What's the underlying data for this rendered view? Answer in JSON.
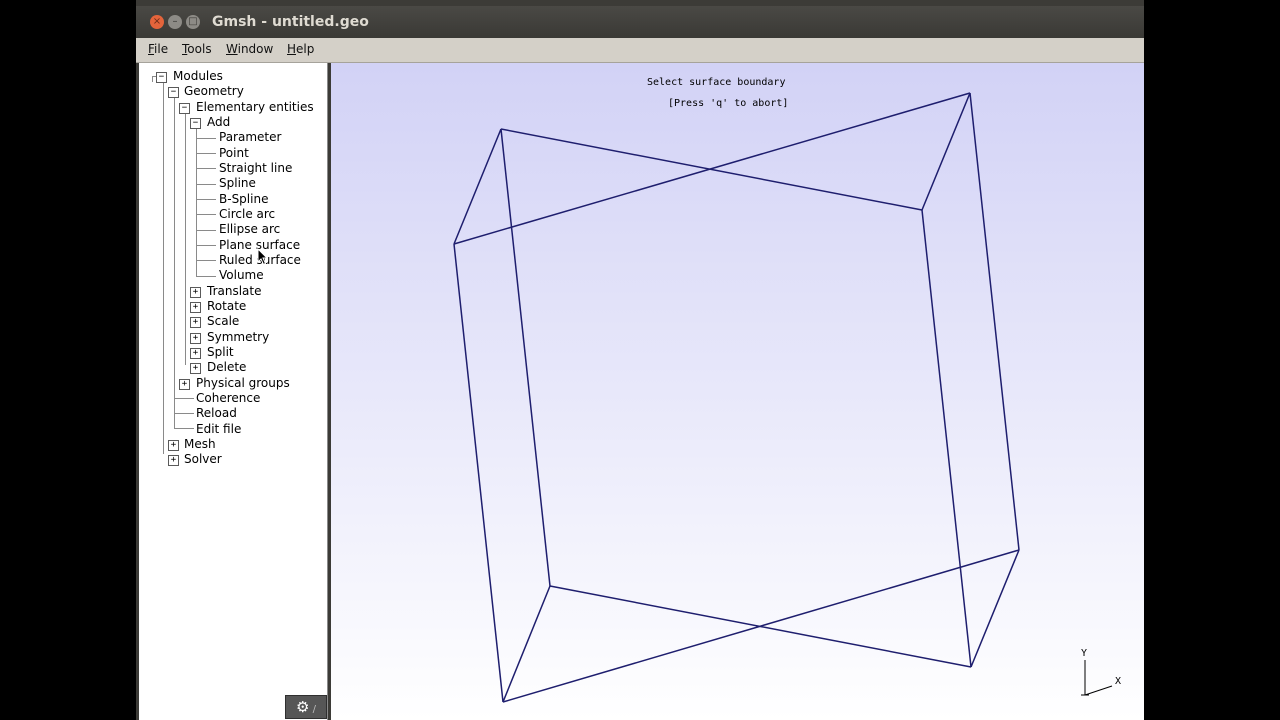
{
  "window": {
    "title": "Gmsh - untitled.geo",
    "close_glyph": "×",
    "min_glyph": "–",
    "max_glyph": "□"
  },
  "menu": {
    "file": {
      "u": "F",
      "rest": "ile"
    },
    "tools": {
      "u": "T",
      "rest": "ools"
    },
    "window": {
      "u": "W",
      "rest": "indow"
    },
    "help": {
      "u": "H",
      "rest": "elp"
    }
  },
  "tree": {
    "modules": "Modules",
    "geometry": "Geometry",
    "elementary": "Elementary entities",
    "add": "Add",
    "parameter": "Parameter",
    "point": "Point",
    "straight_line": "Straight line",
    "spline": "Spline",
    "bspline": "B-Spline",
    "circle_arc": "Circle arc",
    "ellipse_arc": "Ellipse arc",
    "plane_surface": "Plane surface",
    "ruled_surface": "Ruled surface",
    "volume": "Volume",
    "translate": "Translate",
    "rotate": "Rotate",
    "scale": "Scale",
    "symmetry": "Symmetry",
    "split": "Split",
    "delete": "Delete",
    "physical_groups": "Physical groups",
    "coherence": "Coherence",
    "reload": "Reload",
    "edit_file": "Edit file",
    "mesh": "Mesh",
    "solver": "Solver",
    "minus": "−",
    "plus": "+"
  },
  "status": {
    "select_msg": "Select surface boundary",
    "abort_msg": "[Press 'q' to abort]"
  },
  "axes": {
    "y": "Y",
    "x": "X"
  },
  "colors": {
    "wireframe": "#1e1e6e",
    "viewport_top": "#d2d2f6",
    "viewport_bottom": "#ffffff"
  }
}
